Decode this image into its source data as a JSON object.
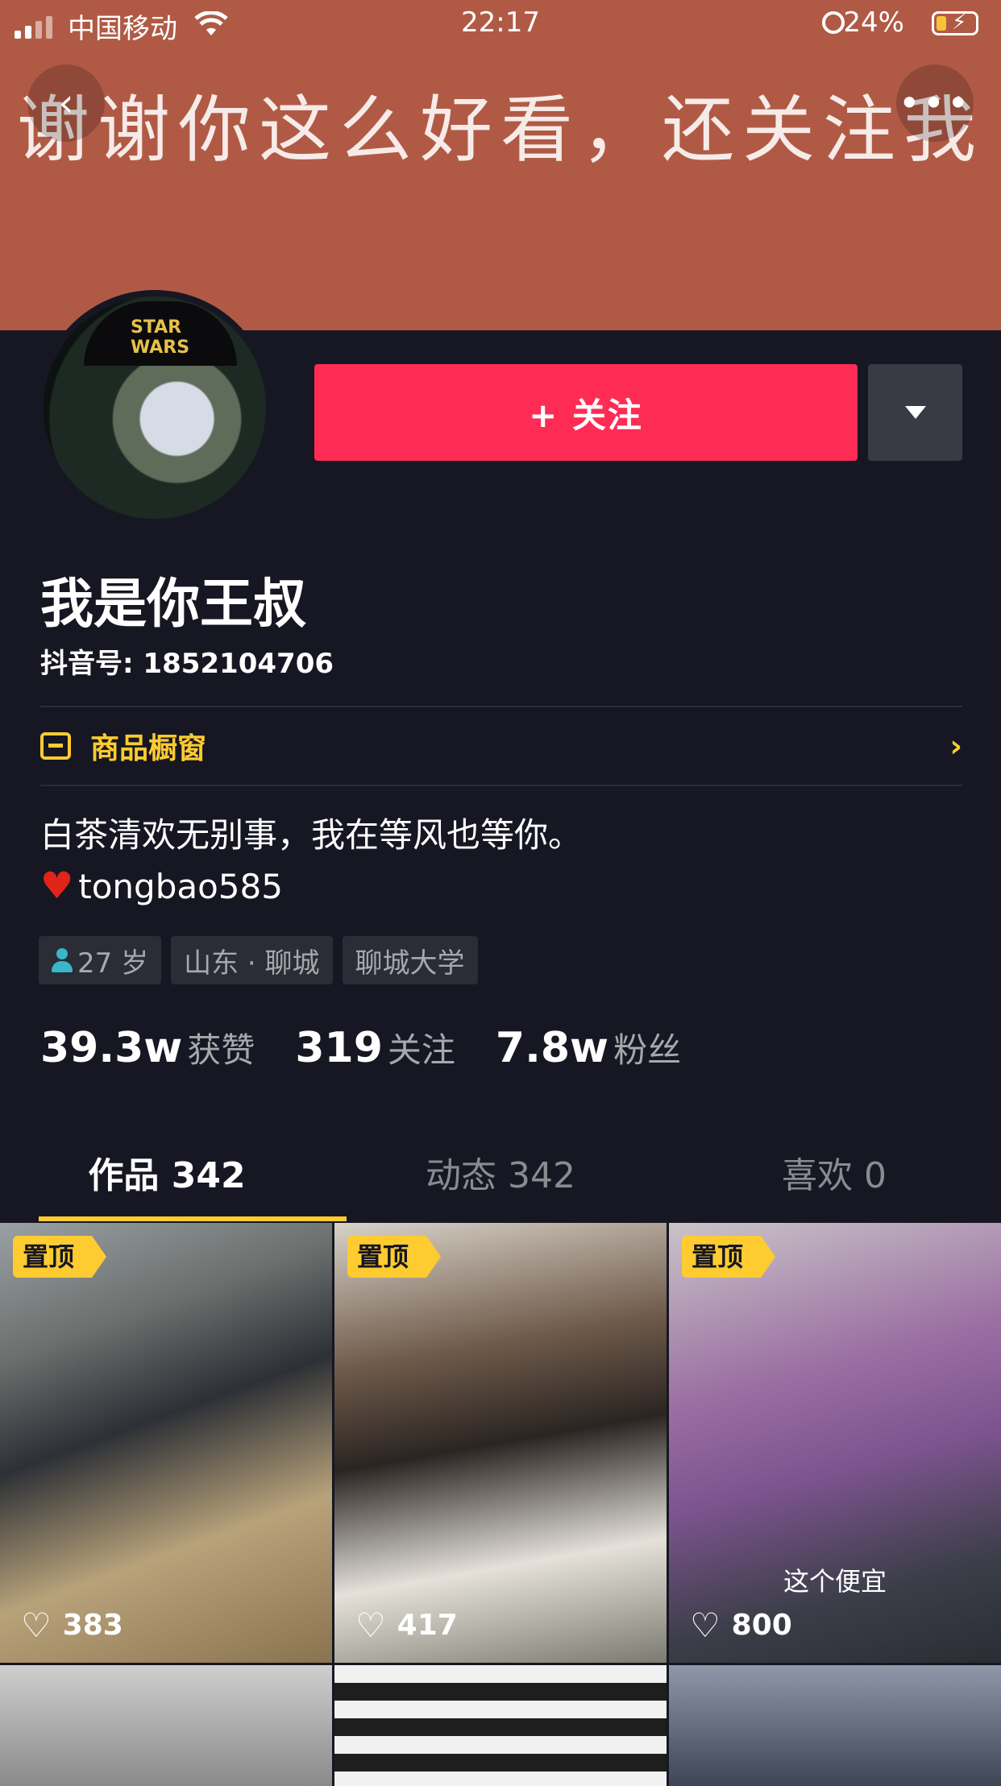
{
  "status_bar": {
    "carrier": "中国移动",
    "time": "22:17",
    "battery": "24%"
  },
  "cover": {
    "text": "谢谢你这么好看，还关注我",
    "color": "#b05a45"
  },
  "header": {
    "back_icon": "back-icon",
    "more_icon": "more-icon"
  },
  "profile": {
    "avatar_text": "STAR WARS",
    "follow_label": "+ 关注",
    "name": "我是你王叔",
    "douyin_id": "抖音号: 1852104706",
    "shop_label": "商品橱窗",
    "bio_line1": "白茶清欢无别事，我在等风也等你。",
    "bio_line2": "tongbao585",
    "tags": [
      "27 岁",
      "山东 · 聊城",
      "聊城大学"
    ]
  },
  "stats": [
    {
      "num": "39.3w",
      "label": "获赞"
    },
    {
      "num": "319",
      "label": "关注"
    },
    {
      "num": "7.8w",
      "label": "粉丝"
    }
  ],
  "tabs": [
    {
      "label": "作品 342"
    },
    {
      "label": "动态 342"
    },
    {
      "label": "喜欢 0"
    }
  ],
  "videos": [
    {
      "pinned": "置顶",
      "likes": "383",
      "caption": ""
    },
    {
      "pinned": "置顶",
      "likes": "417",
      "caption": ""
    },
    {
      "pinned": "置顶",
      "likes": "800",
      "caption": "这个便宜"
    }
  ],
  "colors": {
    "accent": "#fe2c55",
    "highlight": "#fecb31",
    "background": "#161722"
  }
}
